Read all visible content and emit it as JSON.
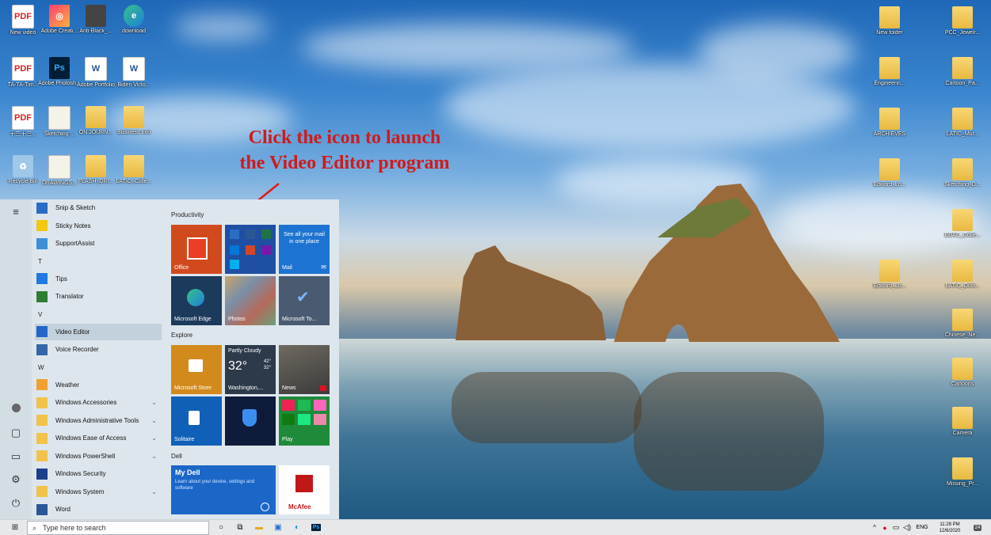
{
  "annotation": {
    "line1": "Click the icon to launch",
    "line2": "the Video Editor program"
  },
  "desktop_icons_left": [
    {
      "label": "New video",
      "glyph": "PDF",
      "kind": "pdf"
    },
    {
      "label": "Adobe Creati...",
      "glyph": "◎",
      "kind": "cc"
    },
    {
      "label": "Anti-Black_...",
      "glyph": "",
      "kind": "dark"
    },
    {
      "label": "download",
      "glyph": "e",
      "kind": "edge"
    },
    {
      "label": "TA-TA-Tim...",
      "glyph": "PDF",
      "kind": "pdf"
    },
    {
      "label": "Adobe Photosh...",
      "glyph": "Ps",
      "kind": "ps"
    },
    {
      "label": "Adobe Portfolio",
      "glyph": "W",
      "kind": "word"
    },
    {
      "label": "Biden Victo...",
      "glyph": "W",
      "kind": "word"
    },
    {
      "label": "十三十三...",
      "glyph": "PDF",
      "kind": "pdf"
    },
    {
      "label": "Sketching ...",
      "glyph": "",
      "kind": "doc"
    },
    {
      "label": "ON JOURN...",
      "glyph": "",
      "kind": "folder"
    },
    {
      "label": "Business Info",
      "glyph": "",
      "kind": "folder"
    },
    {
      "label": "Recycle Bin",
      "glyph": "♻",
      "kind": "bin"
    },
    {
      "label": "DRAWINGS...",
      "glyph": "",
      "kind": "doc"
    },
    {
      "label": "FLASH_DRI...",
      "glyph": "",
      "kind": "folder"
    },
    {
      "label": "LATIC_Colle...",
      "glyph": "",
      "kind": "folder"
    }
  ],
  "desktop_icons_right": [
    {
      "label": "New folder"
    },
    {
      "label": "PCC_Jewelr..."
    },
    {
      "label": "Engineerin..."
    },
    {
      "label": "Cartoon_Pa..."
    },
    {
      "label": "ARCHIEVES"
    },
    {
      "label": "LATIC_Mur..."
    },
    {
      "label": "Edward_Lo..."
    },
    {
      "label": "Sketching_D..."
    },
    {
      "label": "EDAC_Colle..."
    },
    {
      "label": "Edward_Lo..."
    },
    {
      "label": "LATIC_Dow..."
    },
    {
      "label": "Chinese_Ne..."
    },
    {
      "label": "Cartoons"
    },
    {
      "label": "Camera"
    },
    {
      "label": "Missing_Pr..."
    }
  ],
  "start_menu": {
    "apps": [
      {
        "label": "Snip & Sketch",
        "color": "#2b6cc4"
      },
      {
        "label": "Sticky Notes",
        "color": "#f2c811"
      },
      {
        "label": "SupportAssist",
        "color": "#3a8fd6"
      },
      {
        "letter": "T"
      },
      {
        "label": "Tips",
        "color": "#1f7be0"
      },
      {
        "label": "Translator",
        "color": "#2e7d32"
      },
      {
        "letter": "V"
      },
      {
        "label": "Video Editor",
        "color": "#2266c8",
        "selected": true
      },
      {
        "label": "Voice Recorder",
        "color": "#3566a8"
      },
      {
        "letter": "W"
      },
      {
        "label": "Weather",
        "color": "#f0a030"
      },
      {
        "label": "Windows Accessories",
        "color": "#f2c34a",
        "chevron": "⌄"
      },
      {
        "label": "Windows Administrative Tools",
        "color": "#f2c34a",
        "chevron": "⌄"
      },
      {
        "label": "Windows Ease of Access",
        "color": "#f2c34a",
        "chevron": "⌄"
      },
      {
        "label": "Windows PowerShell",
        "color": "#f2c34a",
        "chevron": "⌄"
      },
      {
        "label": "Windows Security",
        "color": "#1b3f8a"
      },
      {
        "label": "Windows System",
        "color": "#f2c34a",
        "chevron": "⌄"
      },
      {
        "label": "Word",
        "color": "#2b5797"
      }
    ],
    "groups": {
      "productivity": "Productivity",
      "explore": "Explore",
      "dell": "Dell"
    },
    "tiles": {
      "office": "Office",
      "mail": "Mail",
      "mail_promo": "See all your mail in one place",
      "edge": "Microsoft Edge",
      "photos": "Photos",
      "todo": "Microsoft To...",
      "store": "Microsoft Store",
      "weather_title": "Partly Cloudy",
      "weather_temp": "32°",
      "weather_hi": "42°",
      "weather_lo": "32°",
      "weather_city": "Washington,...",
      "news": "News",
      "solitaire": "Solitaire",
      "play": "Play",
      "mydell_title": "My Dell",
      "mydell_text": "Learn about your device, settings and software",
      "mcafee": "McAfee"
    }
  },
  "taskbar": {
    "search_placeholder": "Type here to search",
    "lang": "ENG",
    "time": "11:28 PM",
    "date": "12/6/2020",
    "notif_count": "24"
  }
}
